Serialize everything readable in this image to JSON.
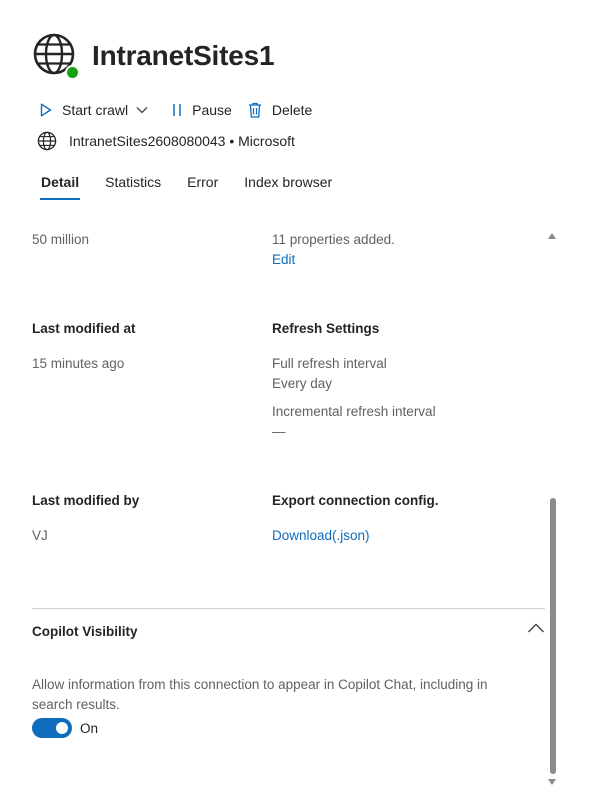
{
  "header": {
    "title": "IntranetSites1",
    "icon": "globe-icon",
    "status_color": "#13a10e"
  },
  "toolbar": {
    "start_crawl_label": "Start crawl",
    "pause_label": "Pause",
    "delete_label": "Delete"
  },
  "source": {
    "text": "IntranetSites2608080043 • Microsoft"
  },
  "tabs": [
    {
      "label": "Detail",
      "active": true
    },
    {
      "label": "Statistics",
      "active": false
    },
    {
      "label": "Error",
      "active": false
    },
    {
      "label": "Index browser",
      "active": false
    }
  ],
  "details": {
    "items_value": "50 million",
    "properties_value": "11 properties added.",
    "edit_link": "Edit",
    "last_modified_at_label": "Last modified at",
    "last_modified_at_value": "15 minutes ago",
    "refresh_label": "Refresh Settings",
    "full_refresh_label": "Full refresh interval",
    "full_refresh_value": "Every day",
    "incremental_refresh_label": "Incremental refresh interval",
    "incremental_refresh_value": "—",
    "last_modified_by_label": "Last modified by",
    "last_modified_by_value": "VJ",
    "export_label": "Export connection config.",
    "download_link": "Download(.json)"
  },
  "copilot": {
    "title": "Copilot Visibility",
    "description_line1": "Allow information from this connection to appear in Copilot Chat, including in",
    "description_line2": "search results.",
    "toggle_label": "On",
    "toggle_on": true
  },
  "colors": {
    "accent": "#0f6cbd",
    "text": "#242424",
    "muted": "#616161"
  }
}
